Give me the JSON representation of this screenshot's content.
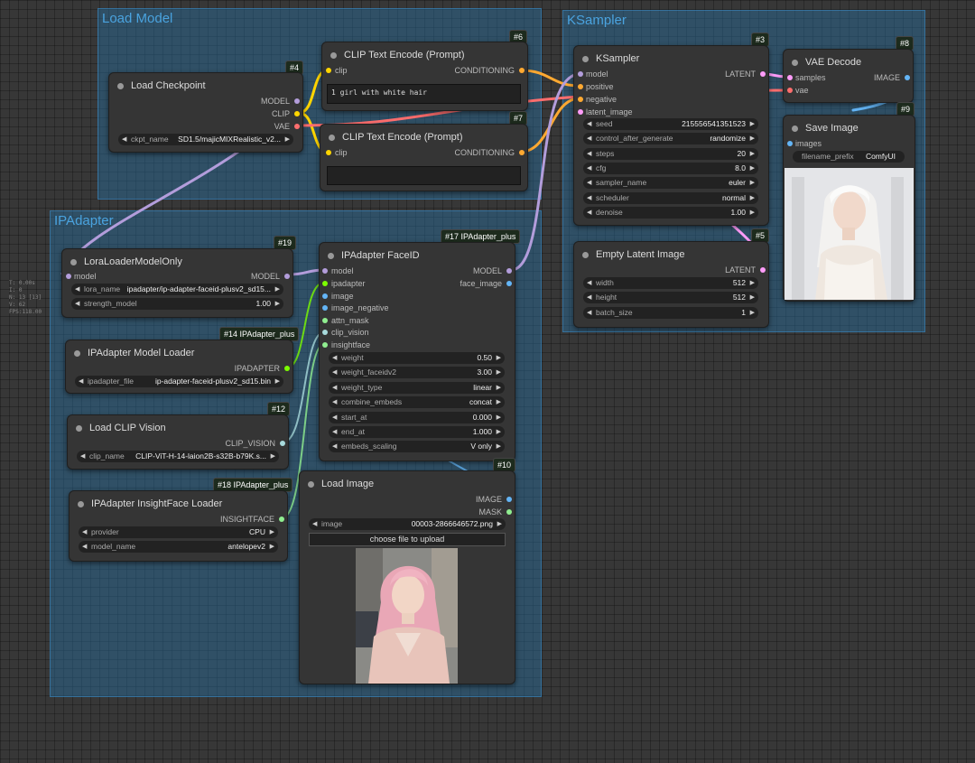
{
  "groups": {
    "load_model": "Load Model",
    "ipadapter": "IPAdapter",
    "ksampler": "KSampler"
  },
  "colors": {
    "model": "#b39ddb",
    "clip": "#ffd500",
    "vae": "#ff6e6e",
    "conditioning": "#ffa931",
    "latent": "#ff9cf9",
    "image": "#64b5f6",
    "ipadapter": "#7cfc00",
    "clip_vision": "#a8dadc",
    "insightface": "#90ee90",
    "group": "#4aa3df"
  },
  "stats": [
    "T: 0.00s",
    "I: 0",
    "N: 13 [13]",
    "V: 62",
    "FPS:118.00"
  ],
  "nodes": {
    "load_checkpoint": {
      "id": "#4",
      "title": "Load Checkpoint",
      "out_model": "MODEL",
      "out_clip": "CLIP",
      "out_vae": "VAE",
      "ckpt_label": "ckpt_name",
      "ckpt_value": "SD1.5/majicMIXRealistic_v2..."
    },
    "clip_pos": {
      "id": "#6",
      "title": "CLIP Text Encode (Prompt)",
      "in_clip": "clip",
      "out": "CONDITIONING",
      "text": "1 girl with white hair"
    },
    "clip_neg": {
      "id": "#7",
      "title": "CLIP Text Encode (Prompt)",
      "in_clip": "clip",
      "out": "CONDITIONING",
      "text": ""
    },
    "ksampler": {
      "id": "#3",
      "title": "KSampler",
      "inputs": [
        "model",
        "positive",
        "negative",
        "latent_image"
      ],
      "out": "LATENT",
      "widgets": [
        {
          "label": "seed",
          "value": "215556541351523"
        },
        {
          "label": "control_after_generate",
          "value": "randomize"
        },
        {
          "label": "steps",
          "value": "20"
        },
        {
          "label": "cfg",
          "value": "8.0"
        },
        {
          "label": "sampler_name",
          "value": "euler"
        },
        {
          "label": "scheduler",
          "value": "normal"
        },
        {
          "label": "denoise",
          "value": "1.00"
        }
      ]
    },
    "vae_decode": {
      "id": "#8",
      "title": "VAE Decode",
      "in_samples": "samples",
      "in_vae": "vae",
      "out": "IMAGE"
    },
    "save_image": {
      "id": "#9",
      "title": "Save Image",
      "in_images": "images",
      "prefix_label": "filename_prefix",
      "prefix_value": "ComfyUI"
    },
    "empty_latent": {
      "id": "#5",
      "title": "Empty Latent Image",
      "out": "LATENT",
      "widgets": [
        {
          "label": "width",
          "value": "512"
        },
        {
          "label": "height",
          "value": "512"
        },
        {
          "label": "batch_size",
          "value": "1"
        }
      ]
    },
    "lora": {
      "id": "#19",
      "title": "LoraLoaderModelOnly",
      "in_model": "model",
      "out": "MODEL",
      "widgets": [
        {
          "label": "lora_name",
          "value": "ipadapter/ip-adapter-faceid-plusv2_sd15..."
        },
        {
          "label": "strength_model",
          "value": "1.00"
        }
      ]
    },
    "faceid": {
      "id": "#17 IPAdapter_plus",
      "title": "IPAdapter FaceID",
      "inputs": [
        "model",
        "ipadapter",
        "image",
        "image_negative",
        "attn_mask",
        "clip_vision",
        "insightface"
      ],
      "out_model": "MODEL",
      "out_face": "face_image",
      "widgets": [
        {
          "label": "weight",
          "value": "0.50"
        },
        {
          "label": "weight_faceidv2",
          "value": "3.00"
        },
        {
          "label": "weight_type",
          "value": "linear"
        },
        {
          "label": "combine_embeds",
          "value": "concat"
        },
        {
          "label": "start_at",
          "value": "0.000"
        },
        {
          "label": "end_at",
          "value": "1.000"
        },
        {
          "label": "embeds_scaling",
          "value": "V only"
        }
      ]
    },
    "model_loader": {
      "id": "#14 IPAdapter_plus",
      "title": "IPAdapter Model Loader",
      "out": "IPADAPTER",
      "label": "ipadapter_file",
      "value": "ip-adapter-faceid-plusv2_sd15.bin"
    },
    "clip_vision": {
      "id": "#12",
      "title": "Load CLIP Vision",
      "out": "CLIP_VISION",
      "label": "clip_name",
      "value": "CLIP-ViT-H-14-laion2B-s32B-b79K.s..."
    },
    "insightface": {
      "id": "#18 IPAdapter_plus",
      "title": "IPAdapter InsightFace Loader",
      "out": "INSIGHTFACE",
      "widgets": [
        {
          "label": "provider",
          "value": "CPU"
        },
        {
          "label": "model_name",
          "value": "antelopev2"
        }
      ]
    },
    "load_image": {
      "id": "#10",
      "title": "Load Image",
      "out_image": "IMAGE",
      "out_mask": "MASK",
      "label": "image",
      "value": "00003-2866646572.png",
      "button": "choose file to upload"
    }
  }
}
